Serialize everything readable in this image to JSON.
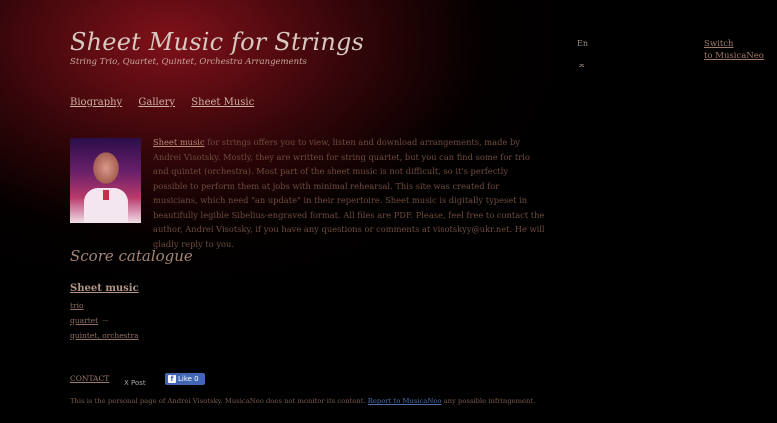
{
  "header": {
    "title": "Sheet Music for Strings",
    "subtitle": "String Trio, Quartet, Quintet, Orchestra Arrangements",
    "lang": "En",
    "lang_icon_text": "ᆽ",
    "switch_label_1": "Switch",
    "switch_label_2": "to MusicaNeo"
  },
  "nav": {
    "items": [
      {
        "label": "Biography"
      },
      {
        "label": "Gallery"
      },
      {
        "label": "Sheet Music"
      }
    ]
  },
  "intro": {
    "link_text": "Sheet music",
    "text": " for strings offers you to view, listen and download arrangements, made by Andrei Visotsky. Mostly, they are written for string quartet, but you can find some for trio and quintet (orchestra). Most part of the sheet music is not difficult, so it's perfectly possible to perform them at jobs with minimal rehearsal. This site was created for musicians, which need \"an update\" in their repertoire. Sheet music is digitally typeset in beautifully legible Sibelius-engraved format. All files are PDF. Please, feel free to contact the author, Andrei Visotsky, if you have any questions or comments at visotskyy@ukr.net. He will gladly reply to you."
  },
  "catalogue": {
    "heading": "Score catalogue",
    "title": "Sheet music",
    "items": [
      {
        "label": "trio",
        "arrow": ""
      },
      {
        "label": "quartet",
        "arrow": "→"
      },
      {
        "label": "quintet, orchestra",
        "arrow": ""
      }
    ]
  },
  "social": {
    "contact": "CONTACT",
    "tweet": "X Post",
    "like": "Like 0",
    "fb_icon": "f"
  },
  "footer": {
    "text_before": "This is the personal page of Andrei Visotsky. MusicaNeo does not monitor its content. ",
    "link": "Report to MusicaNeo",
    "text_after": " any possible infringement."
  },
  "colors": {
    "background": "#000000",
    "title": "#d8c9c0",
    "link": "#d0b2a4",
    "facebook": "#4267b2"
  }
}
